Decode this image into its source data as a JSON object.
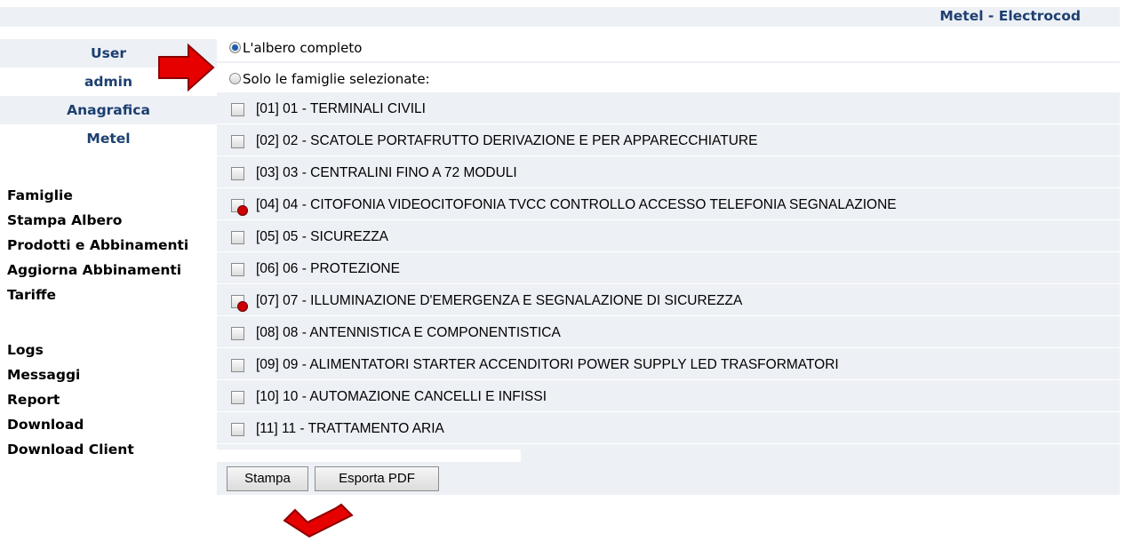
{
  "header": {
    "title": "Metel - Electrocod"
  },
  "sidebar": {
    "top": [
      {
        "label": "User",
        "style": "shaded"
      },
      {
        "label": "admin",
        "style": "white"
      },
      {
        "label": "Anagrafica",
        "style": "shaded"
      },
      {
        "label": "Metel",
        "style": "white"
      }
    ],
    "group1": [
      "Famiglie",
      "Stampa Albero",
      "Prodotti e Abbinamenti",
      "Aggiorna Abbinamenti",
      "Tariffe"
    ],
    "group2": [
      "Logs",
      "Messaggi",
      "Report",
      "Download",
      "Download Client"
    ]
  },
  "options": {
    "full_tree": "L'albero completo",
    "selected_only": "Solo le famiglie selezionate:",
    "selected_value": "full_tree"
  },
  "families": [
    {
      "label": "[01] 01 - TERMINALI CIVILI",
      "marked": false
    },
    {
      "label": "[02] 02 - SCATOLE PORTAFRUTTO DERIVAZIONE E PER APPARECCHIATURE",
      "marked": false
    },
    {
      "label": "[03] 03 - CENTRALINI FINO A 72 MODULI",
      "marked": false
    },
    {
      "label": "[04] 04 - CITOFONIA VIDEOCITOFONIA TVCC CONTROLLO ACCESSO TELEFONIA SEGNALAZIONE",
      "marked": true
    },
    {
      "label": "[05] 05 - SICUREZZA",
      "marked": false
    },
    {
      "label": "[06] 06 - PROTEZIONE",
      "marked": false
    },
    {
      "label": "[07] 07 - ILLUMINAZIONE D'EMERGENZA E SEGNALAZIONE DI SICUREZZA",
      "marked": true
    },
    {
      "label": "[08] 08 - ANTENNISTICA E COMPONENTISTICA",
      "marked": false
    },
    {
      "label": "[09] 09 - ALIMENTATORI STARTER ACCENDITORI POWER SUPPLY LED TRASFORMATORI",
      "marked": false
    },
    {
      "label": "[10] 10 - AUTOMAZIONE CANCELLI E INFISSI",
      "marked": false
    },
    {
      "label": "[11] 11 - TRATTAMENTO ARIA",
      "marked": false
    }
  ],
  "buttons": {
    "print": "Stampa",
    "export": "Esporta PDF"
  },
  "colors": {
    "accent": "#1c3f70",
    "panel": "#edf0f5",
    "annotation": "#e60000",
    "marker": "#cc0000"
  }
}
